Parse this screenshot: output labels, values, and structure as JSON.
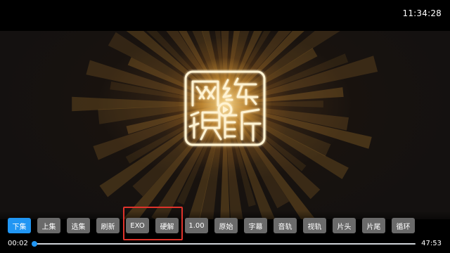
{
  "status_bar": {
    "clock": "11:34:28"
  },
  "video": {
    "logo_icon": "wangfei-shiting-seal-logo-icon",
    "glow_color": "#f0aa3c"
  },
  "controls": {
    "buttons": [
      {
        "label": "下集",
        "active": true
      },
      {
        "label": "上集",
        "active": false
      },
      {
        "label": "选集",
        "active": false
      },
      {
        "label": "刷新",
        "active": false
      },
      {
        "label": "EXO",
        "active": false
      },
      {
        "label": "硬解",
        "active": false
      },
      {
        "label": "1.00",
        "active": false
      },
      {
        "label": "原始",
        "active": false
      },
      {
        "label": "字幕",
        "active": false
      },
      {
        "label": "音轨",
        "active": false
      },
      {
        "label": "视轨",
        "active": false
      },
      {
        "label": "片头",
        "active": false
      },
      {
        "label": "片尾",
        "active": false
      },
      {
        "label": "循环",
        "active": false
      }
    ],
    "highlighted_labels": [
      "EXO",
      "硬解"
    ],
    "active_color": "#2196f3",
    "button_color": "#6a6a6a",
    "highlight_color": "#e0332b"
  },
  "progress": {
    "current_time": "00:02",
    "total_time": "47:53",
    "fraction": 0.0007
  }
}
